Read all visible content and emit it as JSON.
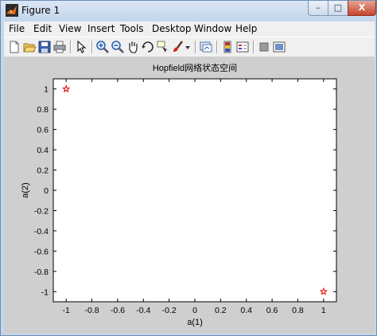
{
  "window": {
    "title": "Figure 1",
    "controls": {
      "minimize": "–",
      "maximize": "□",
      "close": "X"
    }
  },
  "menubar": {
    "items": [
      "File",
      "Edit",
      "View",
      "Insert",
      "Tools",
      "Desktop",
      "Window",
      "Help"
    ]
  },
  "toolbar": {
    "icons": [
      "new-figure-icon",
      "open-file-icon",
      "save-icon",
      "print-icon",
      "edit-plot-arrow-icon",
      "zoom-in-icon",
      "zoom-out-icon",
      "pan-hand-icon",
      "rotate-3d-icon",
      "data-cursor-icon",
      "brush-icon",
      "brush-dropdown-icon",
      "link-plot-icon",
      "insert-colorbar-icon",
      "insert-legend-icon",
      "hide-plot-tools-icon",
      "show-plot-tools-icon"
    ]
  },
  "chart_data": {
    "type": "scatter",
    "title": "Hopfield网络状态空间",
    "xlabel": "a(1)",
    "ylabel": "a(2)",
    "xlim": [
      -1.1,
      1.1
    ],
    "ylim": [
      -1.1,
      1.1
    ],
    "xticks": [
      -1,
      -0.8,
      -0.6,
      -0.4,
      -0.2,
      0,
      0.2,
      0.4,
      0.6,
      0.8,
      1
    ],
    "yticks": [
      1,
      0.8,
      0.6,
      0.4,
      0.2,
      0,
      -0.2,
      -0.4,
      -0.6,
      -0.8,
      -1
    ],
    "grid": false,
    "marker": "pentagram",
    "marker_color": "#e00000",
    "points": [
      {
        "x": -1,
        "y": 1
      },
      {
        "x": 1,
        "y": -1
      }
    ]
  }
}
